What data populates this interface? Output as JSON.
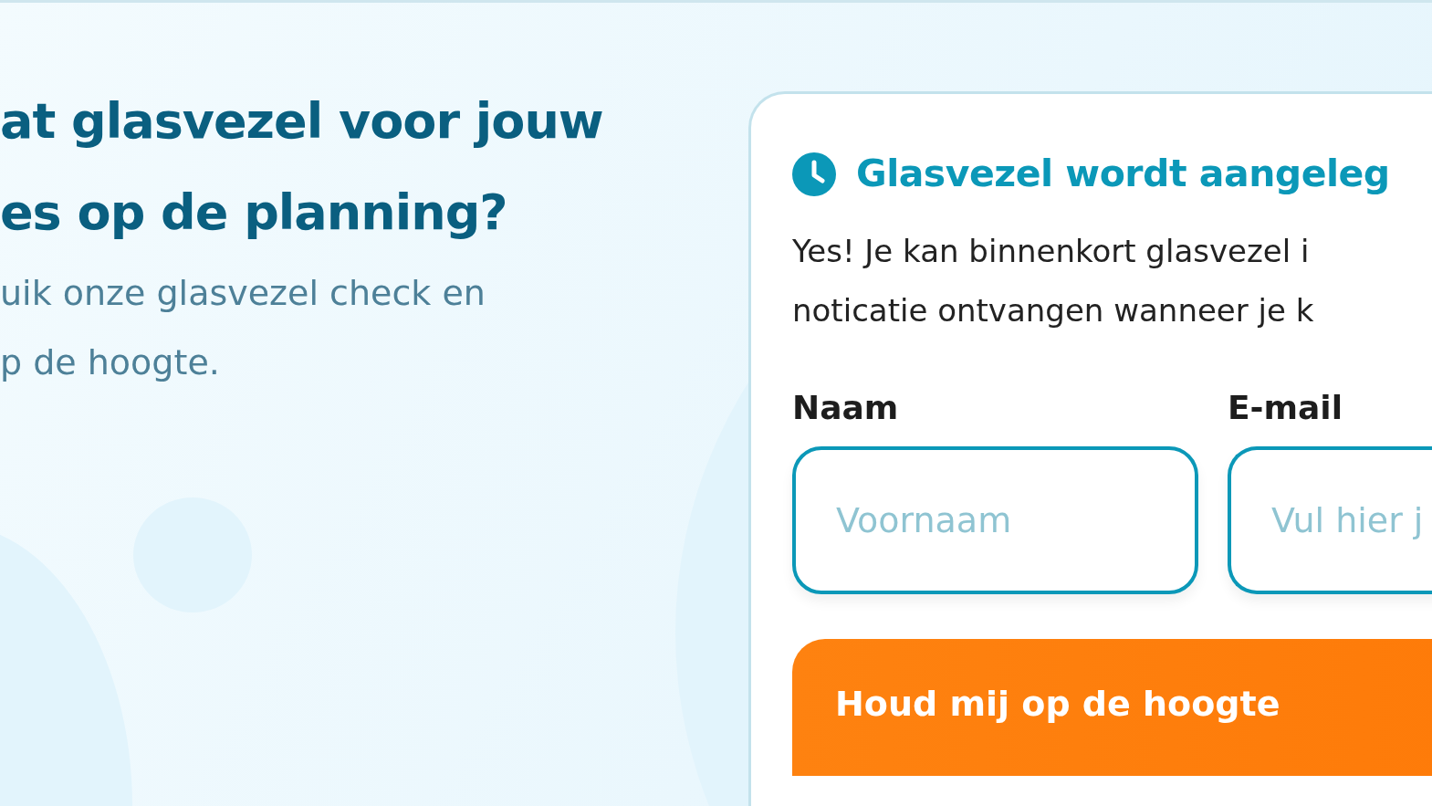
{
  "hero": {
    "heading_lines": [
      "at glasvezel voor jouw",
      "es op de planning?"
    ],
    "intro_lines": [
      "uik onze glasvezel check en",
      "p de hoogte."
    ]
  },
  "card": {
    "title": "Glasvezel wordt aangeleg",
    "text_lines": [
      "Yes! Je kan binnenkort glasvezel i",
      "noticatie ontvangen wanneer je k"
    ],
    "fields": [
      {
        "label": "Naam",
        "placeholder": "Voornaam"
      },
      {
        "label": "E-mail",
        "placeholder": "Vul hier j"
      }
    ],
    "button": "Houd mij op de hoogte"
  }
}
